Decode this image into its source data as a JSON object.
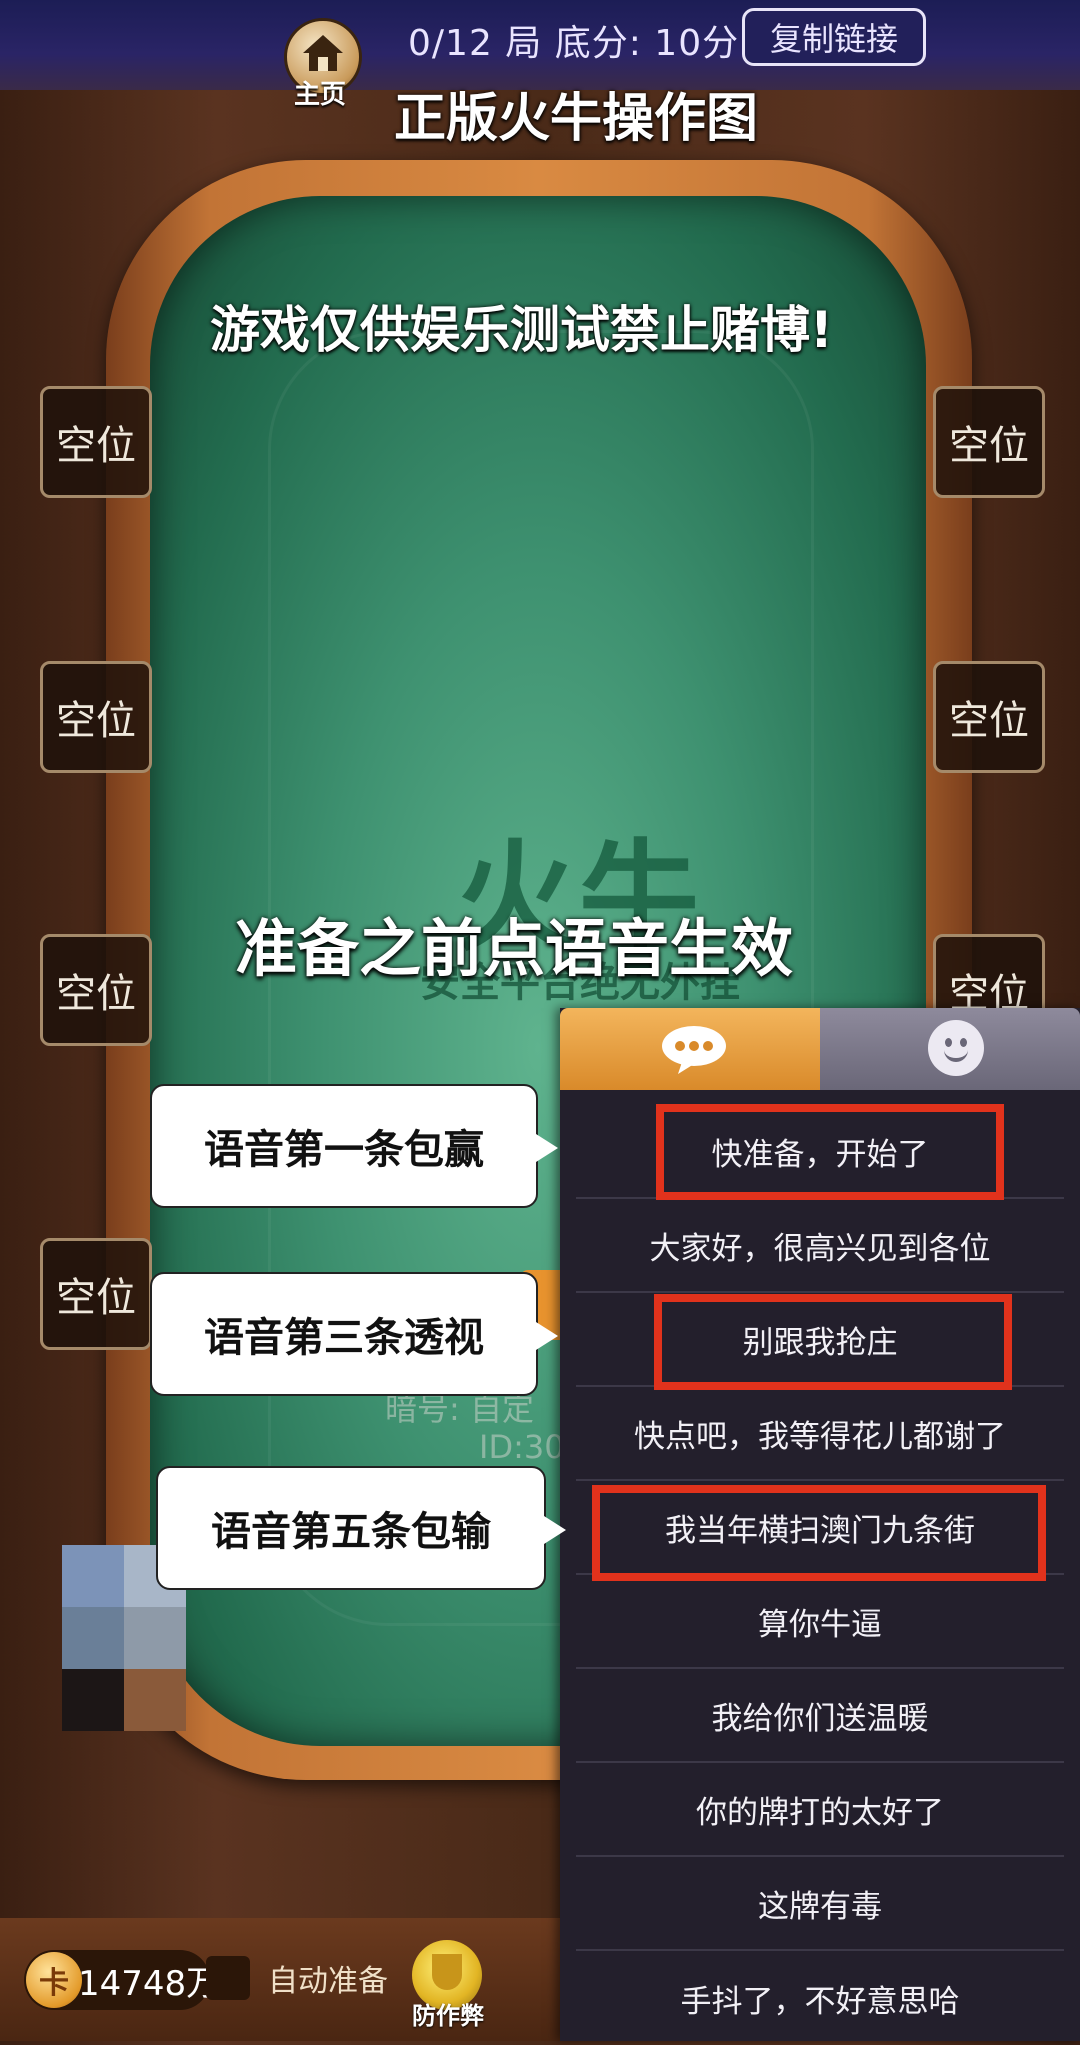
{
  "header": {
    "home_label": "主页",
    "round_info": "0/12 局  底分: 10分",
    "copy_link": "复制链接",
    "banner": "正版火牛操作图"
  },
  "table": {
    "warning": "游戏仅供娱乐测试禁止赌博!",
    "center_note": "准备之前点语音生效",
    "logo": "火牛",
    "slogan": "安全平台绝无外挂",
    "room_code": "暗号: 自定",
    "room_id": "ID:30"
  },
  "seats": [
    "空位",
    "空位",
    "空位",
    "空位",
    "空位",
    "空位",
    "空位"
  ],
  "footer": {
    "coins": "14748万",
    "coin_symbol": "卡",
    "auto_ready": "自动准备",
    "anti_cheat": "防作弊"
  },
  "chat": {
    "tab_voice_icon": "speech-bubble-icon",
    "tab_emoji_icon": "smiley-face-icon",
    "phrases": [
      "快准备，开始了",
      "大家好，很高兴见到各位",
      "别跟我抢庄",
      "快点吧，我等得花儿都谢了",
      "我当年横扫澳门九条街",
      "算你牛逼",
      "我给你们送温暖",
      "你的牌打的太好了",
      "这牌有毒",
      "手抖了，不好意思哈"
    ]
  },
  "callouts": {
    "first": "语音第一条包赢",
    "third": "语音第三条透视",
    "fifth": "语音第五条包输"
  },
  "colors": {
    "highlight_red": "#e1321c",
    "felt_green": "#3e9170",
    "voice_tab_orange": "#e8a040"
  }
}
